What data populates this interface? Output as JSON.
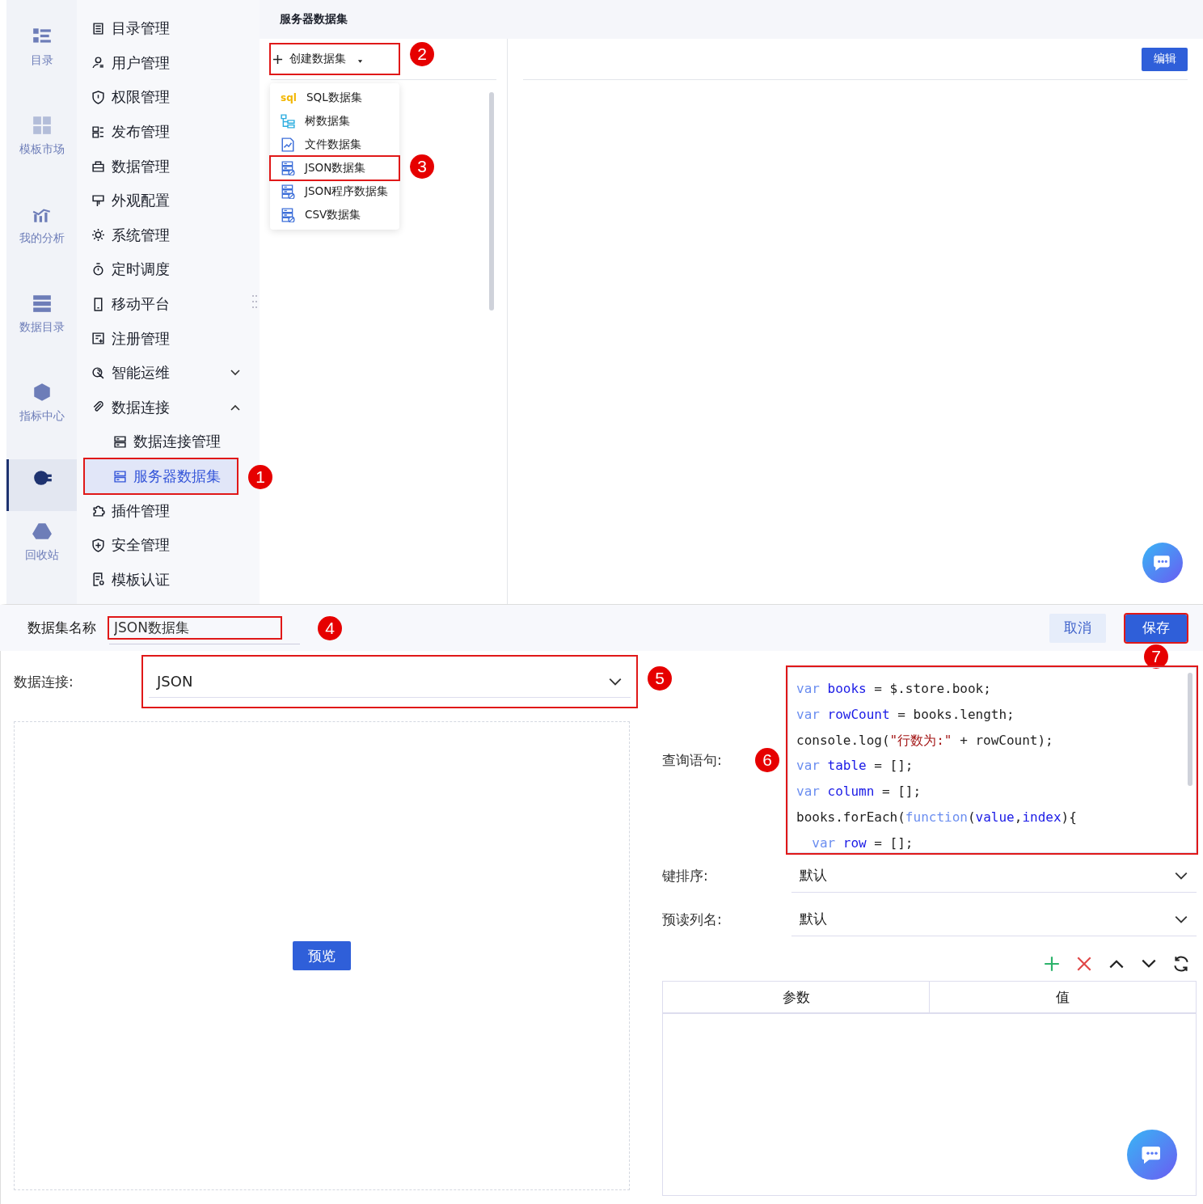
{
  "rail": [
    {
      "label": "目录",
      "selected": false
    },
    {
      "label": "模板市场",
      "selected": false
    },
    {
      "label": "我的分析",
      "selected": false
    },
    {
      "label": "数据目录",
      "selected": false
    },
    {
      "label": "指标中心",
      "selected": false
    },
    {
      "selected": true
    },
    {
      "label": "回收站",
      "selected": false
    }
  ],
  "menu": [
    {
      "label": "目录管理",
      "selected": false
    },
    {
      "label": "用户管理",
      "selected": false
    },
    {
      "label": "权限管理",
      "selected": false
    },
    {
      "label": "发布管理",
      "selected": false
    },
    {
      "label": "数据管理",
      "selected": false
    },
    {
      "label": "外观配置",
      "selected": false
    },
    {
      "label": "系统管理",
      "selected": false
    },
    {
      "label": "定时调度",
      "selected": false
    },
    {
      "label": "移动平台",
      "selected": false
    },
    {
      "label": "注册管理",
      "selected": false
    },
    {
      "label": "智能运维",
      "selected": false,
      "expanded": false
    },
    {
      "label": "数据连接",
      "selected": false,
      "expanded": true,
      "children": [
        {
          "label": "数据连接管理",
          "selected": false
        },
        {
          "label": "服务器数据集",
          "selected": true,
          "annotation": "1"
        }
      ]
    },
    {
      "label": "插件管理",
      "selected": false
    },
    {
      "label": "安全管理",
      "selected": false
    },
    {
      "label": "模板认证",
      "selected": false
    }
  ],
  "panel_title": "服务器数据集",
  "create_button": {
    "label": "创建数据集",
    "annotation": "2"
  },
  "dropdown": [
    {
      "label": "SQL数据集",
      "kind": "sql",
      "icon_text": "sql"
    },
    {
      "label": "树数据集",
      "kind": "tree"
    },
    {
      "label": "文件数据集",
      "kind": "file"
    },
    {
      "label": "JSON数据集",
      "kind": "json",
      "annotation": "3"
    },
    {
      "label": "JSON程序数据集",
      "kind": "json"
    },
    {
      "label": "CSV数据集",
      "kind": "json"
    }
  ],
  "edit_button": "编辑",
  "form": {
    "name_label": "数据集名称",
    "name_value": "JSON数据集",
    "name_annotation": "4",
    "cancel": "取消",
    "save": "保存",
    "save_annotation": "7",
    "connection_label": "数据连接:",
    "connection_value": "JSON",
    "connection_annotation": "5",
    "preview": "预览",
    "query_label": "查询语句:",
    "query_annotation": "6",
    "code": [
      [
        {
          "t": "var ",
          "kind": "kw"
        },
        {
          "t": "books",
          "kind": "var"
        },
        {
          "t": " = $.store.book;",
          "kind": "plain"
        }
      ],
      [
        {
          "t": "var ",
          "kind": "kw"
        },
        {
          "t": "rowCount",
          "kind": "var"
        },
        {
          "t": " = books.length;",
          "kind": "plain"
        }
      ],
      [
        {
          "t": "console.log(",
          "kind": "plain"
        },
        {
          "t": "\"行数为:\"",
          "kind": "str"
        },
        {
          "t": " + rowCount);",
          "kind": "plain"
        }
      ],
      [
        {
          "t": "var ",
          "kind": "kw"
        },
        {
          "t": "table",
          "kind": "var"
        },
        {
          "t": " = [];",
          "kind": "plain"
        }
      ],
      [
        {
          "t": "var ",
          "kind": "kw"
        },
        {
          "t": "column",
          "kind": "var"
        },
        {
          "t": " = [];",
          "kind": "plain"
        }
      ],
      [
        {
          "t": "books.forEach(",
          "kind": "plain"
        },
        {
          "t": "function",
          "kind": "kw"
        },
        {
          "t": "(",
          "kind": "plain"
        },
        {
          "t": "value",
          "kind": "var"
        },
        {
          "t": ",",
          "kind": "plain"
        },
        {
          "t": "index",
          "kind": "var"
        },
        {
          "t": "){",
          "kind": "plain"
        }
      ],
      [
        {
          "t": "  var ",
          "kind": "kw"
        },
        {
          "t": "row",
          "kind": "var"
        },
        {
          "t": " = [];",
          "kind": "plain"
        }
      ]
    ],
    "selects": [
      {
        "label": "键排序:",
        "value": "默认"
      },
      {
        "label": "预读列名:",
        "value": "默认"
      }
    ],
    "params_columns": [
      "参数",
      "值"
    ]
  }
}
